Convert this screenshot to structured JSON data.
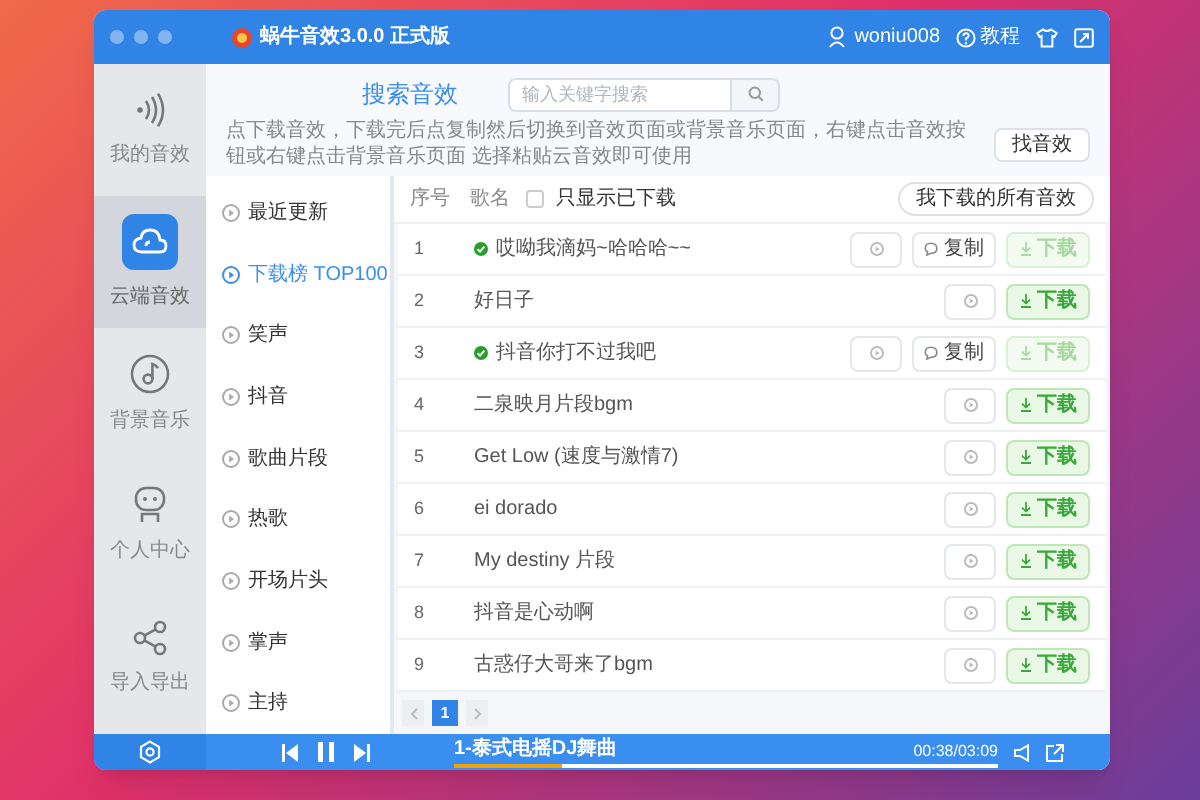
{
  "window": {
    "title": "蜗牛音效3.0.0 正式版"
  },
  "user": {
    "name": "woniu008"
  },
  "help_link": "教程",
  "nav": [
    {
      "label": "我的音效",
      "selected": false,
      "kind": "sound"
    },
    {
      "label": "云端音效",
      "selected": true,
      "kind": "cloud"
    },
    {
      "label": "背景音乐",
      "selected": false,
      "kind": "music"
    },
    {
      "label": "个人中心",
      "selected": false,
      "kind": "person"
    },
    {
      "label": "导入导出",
      "selected": false,
      "kind": "share"
    }
  ],
  "search": {
    "heading": "搜索音效",
    "placeholder": "输入关键字搜索"
  },
  "notice": "点下载音效，下载完后点复制然后切换到音效页面或背景音乐页面，右键点击音效按钮或右键点击背景音乐页面 选择粘贴云音效即可使用",
  "find_button": "找音效",
  "categories": [
    {
      "label": "最近更新",
      "selected": false
    },
    {
      "label": "下载榜 TOP100",
      "selected": true
    },
    {
      "label": "笑声",
      "selected": false
    },
    {
      "label": "抖音",
      "selected": false
    },
    {
      "label": "歌曲片段",
      "selected": false
    },
    {
      "label": "热歌",
      "selected": false
    },
    {
      "label": "开场片头",
      "selected": false
    },
    {
      "label": "掌声",
      "selected": false
    },
    {
      "label": "主持",
      "selected": false
    }
  ],
  "table": {
    "columns": [
      "序号",
      "歌名"
    ],
    "filter": {
      "label": "只显示已下载",
      "checked": false
    },
    "all_downloads_button": "我下载的所有音效",
    "rows": [
      {
        "index": "1",
        "name": "哎呦我滴妈~哈哈哈~~",
        "downloaded": true,
        "copy_label": "复制",
        "download_label": "下载"
      },
      {
        "index": "2",
        "name": "好日子",
        "downloaded": false,
        "download_label": "下载"
      },
      {
        "index": "3",
        "name": "抖音你打不过我吧",
        "downloaded": true,
        "copy_label": "复制",
        "download_label": "下载"
      },
      {
        "index": "4",
        "name": "二泉映月片段bgm",
        "downloaded": false,
        "download_label": "下载"
      },
      {
        "index": "5",
        "name": "Get Low (速度与激情7)",
        "downloaded": false,
        "download_label": "下载"
      },
      {
        "index": "6",
        "name": "ei dorado",
        "downloaded": false,
        "download_label": "下载"
      },
      {
        "index": "7",
        "name": "My destiny 片段",
        "downloaded": false,
        "download_label": "下载"
      },
      {
        "index": "8",
        "name": "抖音是心动啊",
        "downloaded": false,
        "download_label": "下载"
      },
      {
        "index": "9",
        "name": "古惑仔大哥来了bgm",
        "downloaded": false,
        "download_label": "下载"
      }
    ]
  },
  "pager": {
    "pages": [
      {
        "label": "1",
        "selected": true
      }
    ]
  },
  "player": {
    "track": "1-泰式电摇DJ舞曲",
    "time": "00:38/03:09",
    "progress": {
      "level": 0.2
    }
  }
}
